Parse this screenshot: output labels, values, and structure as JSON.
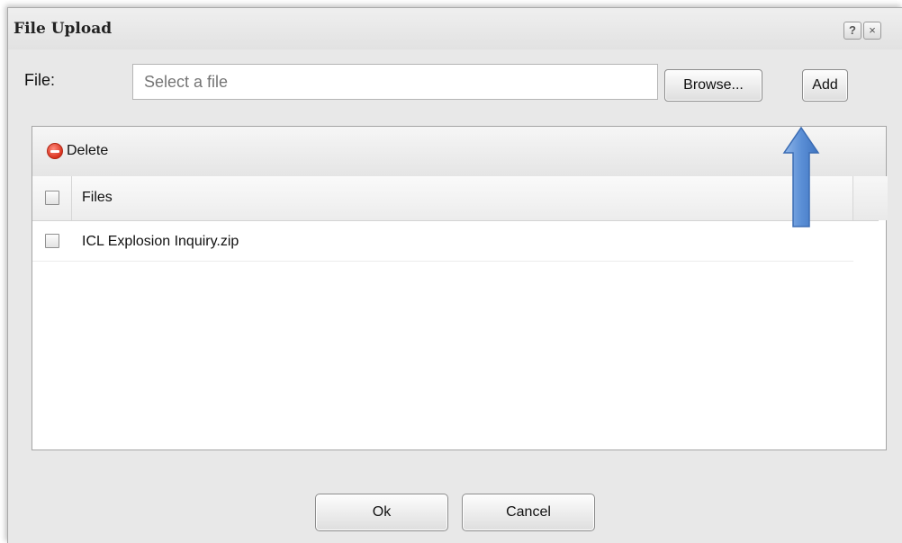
{
  "dialog": {
    "title": "File Upload",
    "help_label": "?",
    "close_label": "×"
  },
  "file_row": {
    "label": "File:",
    "placeholder": "Select a file",
    "browse_label": "Browse...",
    "add_label": "Add"
  },
  "toolbar": {
    "delete_label": "Delete",
    "delete_icon": "remove-circle-icon"
  },
  "grid": {
    "column_header": "Files",
    "rows": [
      {
        "name": "ICL Explosion Inquiry.zip",
        "checked": false
      }
    ]
  },
  "footer": {
    "ok_label": "Ok",
    "cancel_label": "Cancel"
  },
  "annotation": {
    "icon": "up-arrow-icon",
    "color": "#6b9ad6"
  }
}
